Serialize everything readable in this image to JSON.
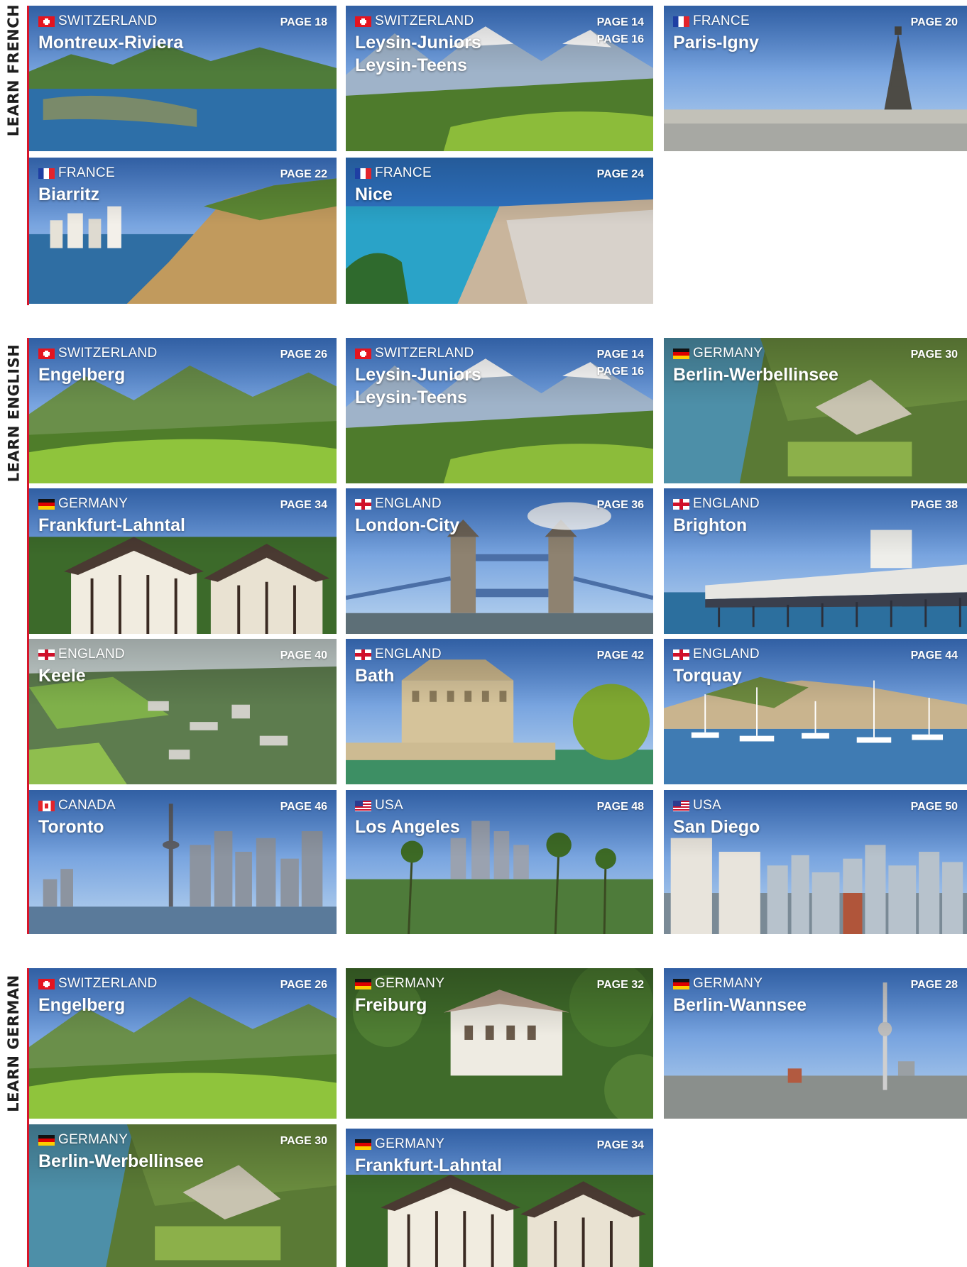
{
  "brand": {
    "accent": "#d6162b"
  },
  "sections": [
    {
      "title": "LEARN FRENCH",
      "cards": [
        {
          "country": "SWITZERLAND",
          "flag": "ch",
          "cities": [
            "Montreux-Riviera"
          ],
          "pages": [
            "PAGE 18"
          ],
          "scene": "lake"
        },
        {
          "country": "SWITZERLAND",
          "flag": "ch",
          "cities": [
            "Leysin-Juniors",
            "Leysin-Teens"
          ],
          "pages": [
            "PAGE 14",
            "PAGE 16"
          ],
          "scene": "alps"
        },
        {
          "country": "FRANCE",
          "flag": "fr",
          "cities": [
            "Paris-Igny"
          ],
          "pages": [
            "PAGE 20"
          ],
          "scene": "paris"
        },
        {
          "country": "FRANCE",
          "flag": "fr",
          "cities": [
            "Biarritz"
          ],
          "pages": [
            "PAGE 22"
          ],
          "scene": "cliff"
        },
        {
          "country": "FRANCE",
          "flag": "fr",
          "cities": [
            "Nice"
          ],
          "pages": [
            "PAGE 24"
          ],
          "scene": "coast"
        }
      ]
    },
    {
      "title": "LEARN ENGLISH",
      "cards": [
        {
          "country": "SWITZERLAND",
          "flag": "ch",
          "cities": [
            "Engelberg"
          ],
          "pages": [
            "PAGE 26"
          ],
          "scene": "valley"
        },
        {
          "country": "SWITZERLAND",
          "flag": "ch",
          "cities": [
            "Leysin-Juniors",
            "Leysin-Teens"
          ],
          "pages": [
            "PAGE 14",
            "PAGE 16"
          ],
          "scene": "alps"
        },
        {
          "country": "GERMANY",
          "flag": "de",
          "cities": [
            "Berlin-Werbellinsee"
          ],
          "pages": [
            "PAGE 30"
          ],
          "scene": "forest"
        },
        {
          "country": "GERMANY",
          "flag": "de",
          "cities": [
            "Frankfurt-Lahntal"
          ],
          "pages": [
            "PAGE 34"
          ],
          "scene": "timber"
        },
        {
          "country": "ENGLAND",
          "flag": "en",
          "cities": [
            "London-City"
          ],
          "pages": [
            "PAGE 36"
          ],
          "scene": "bridge"
        },
        {
          "country": "ENGLAND",
          "flag": "en",
          "cities": [
            "Brighton"
          ],
          "pages": [
            "PAGE 38"
          ],
          "scene": "pier"
        },
        {
          "country": "ENGLAND",
          "flag": "en",
          "cities": [
            "Keele"
          ],
          "pages": [
            "PAGE 40"
          ],
          "scene": "aerial"
        },
        {
          "country": "ENGLAND",
          "flag": "en",
          "cities": [
            "Bath"
          ],
          "pages": [
            "PAGE 42"
          ],
          "scene": "bath"
        },
        {
          "country": "ENGLAND",
          "flag": "en",
          "cities": [
            "Torquay"
          ],
          "pages": [
            "PAGE 44"
          ],
          "scene": "harbour"
        },
        {
          "country": "CANADA",
          "flag": "ca",
          "cities": [
            "Toronto"
          ],
          "pages": [
            "PAGE 46"
          ],
          "scene": "skyline"
        },
        {
          "country": "USA",
          "flag": "us",
          "cities": [
            "Los Angeles"
          ],
          "pages": [
            "PAGE 48"
          ],
          "scene": "palms"
        },
        {
          "country": "USA",
          "flag": "us",
          "cities": [
            "San Diego"
          ],
          "pages": [
            "PAGE 50"
          ],
          "scene": "downtown"
        }
      ]
    },
    {
      "title": "LEARN GERMAN",
      "cards": [
        {
          "country": "SWITZERLAND",
          "flag": "ch",
          "cities": [
            "Engelberg"
          ],
          "pages": [
            "PAGE 26"
          ],
          "scene": "valley"
        },
        {
          "country": "GERMANY",
          "flag": "de",
          "cities": [
            "Freiburg"
          ],
          "pages": [
            "PAGE 32"
          ],
          "scene": "woods"
        },
        {
          "country": "GERMANY",
          "flag": "de",
          "cities": [
            "Berlin-Wannsee"
          ],
          "pages": [
            "PAGE 28"
          ],
          "scene": "tower"
        },
        {
          "country": "GERMANY",
          "flag": "de",
          "cities": [
            "Berlin-Werbellinsee"
          ],
          "pages": [
            "PAGE 30"
          ],
          "scene": "forest"
        },
        {
          "country": "GERMANY",
          "flag": "de",
          "cities": [
            "Frankfurt-Lahntal"
          ],
          "pages": [
            "PAGE 34"
          ],
          "scene": "timber"
        }
      ]
    }
  ]
}
